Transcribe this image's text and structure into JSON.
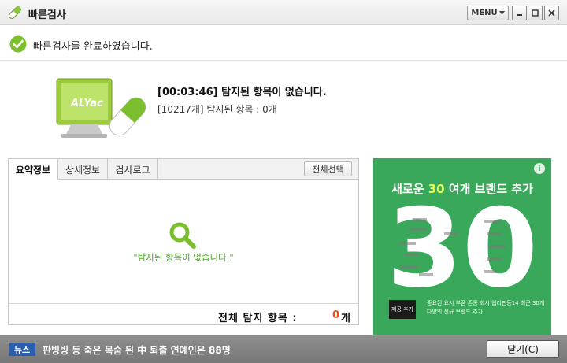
{
  "window": {
    "title": "빠른검사",
    "title_icon": "pill-icon",
    "menu_label": "MENU",
    "controls": [
      "minimize-icon",
      "maximize-icon",
      "close-icon"
    ]
  },
  "status": {
    "icon": "check-circle-icon",
    "text": "빠른검사를 완료하였습니다."
  },
  "result": {
    "logo_text": "ALYac",
    "title": "[00:03:46]  탐지된 항목이 없습니다.",
    "subtitle": "[10217개] 탐지된 항목 : 0개"
  },
  "panel": {
    "tabs": [
      {
        "label": "요약정보",
        "active": true
      },
      {
        "label": "상세정보",
        "active": false
      },
      {
        "label": "검사로그",
        "active": false
      }
    ],
    "select_all_label": "전체선택",
    "empty_icon": "search-icon",
    "empty_message": "\"탐지된 항목이 없습니다.\"",
    "total_label": "전체 탐지 항목 :",
    "total_count": "0",
    "total_unit": "개"
  },
  "ad": {
    "info_label": "i",
    "title_prefix": "새로운 ",
    "title_number": "30",
    "title_suffix": " 여개 브랜드 추가",
    "big_number": "30",
    "badge_text": "제공 추가",
    "body_text": "중요된 요시 부품 존롱 회시 웹리핀등14 최근 30개 다양의 신규 브랜드 추가",
    "colors": {
      "background": "#3aa85a",
      "accent": "#e8ff5a"
    }
  },
  "bottom": {
    "news_label": "뉴스",
    "news_text": "판빙빙 등 죽은 목숨 된 中 퇴출 연예인은 88명",
    "close_label": "닫기(C)"
  }
}
